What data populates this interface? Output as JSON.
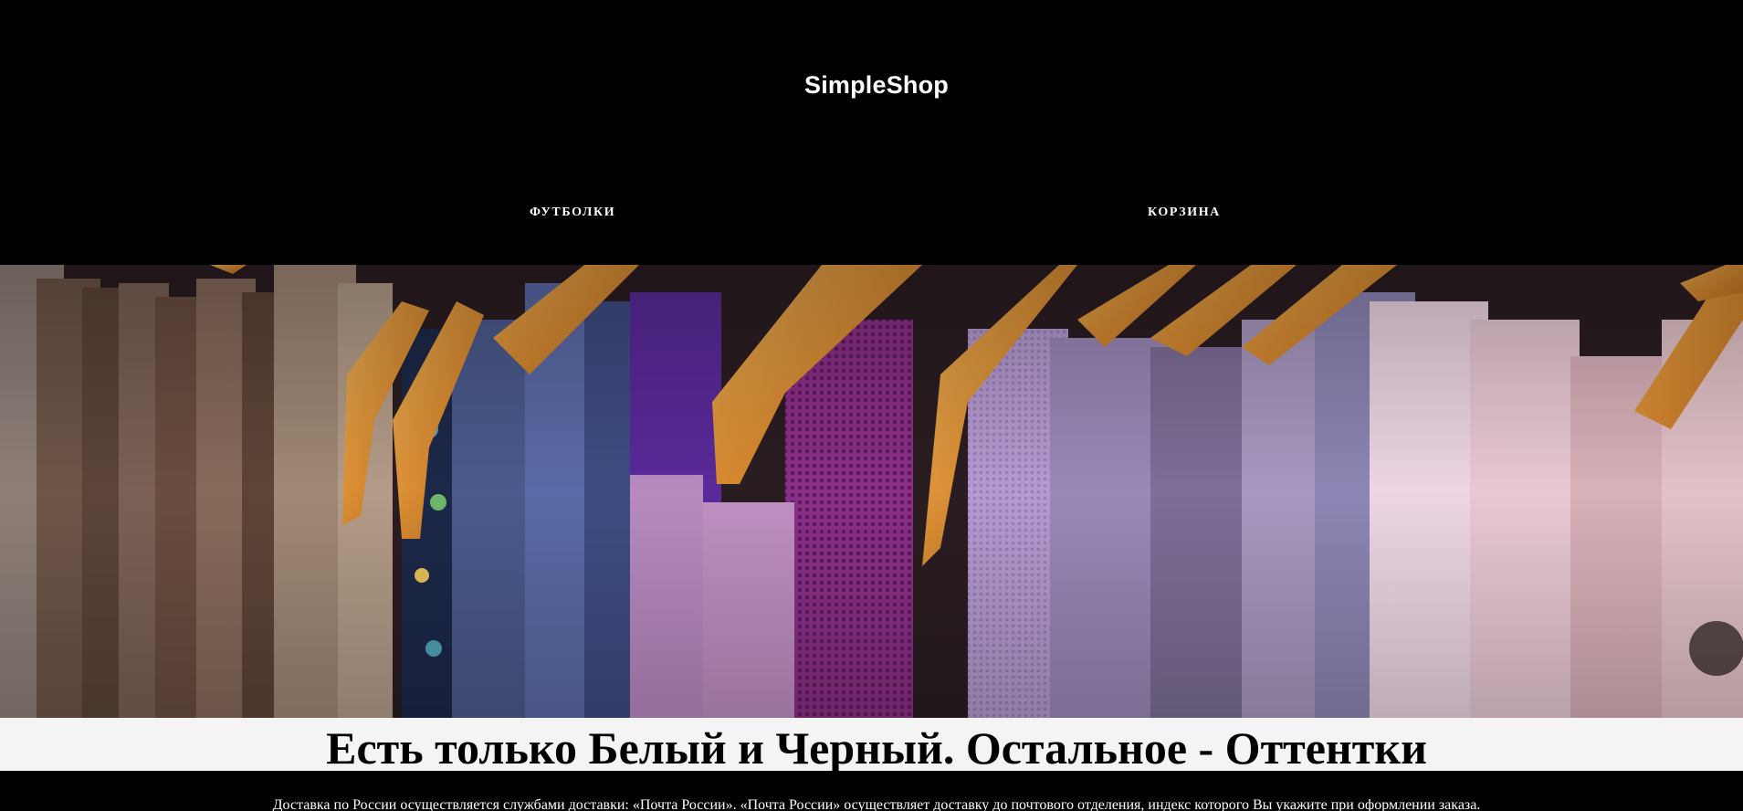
{
  "header": {
    "brand": "SimpleShop",
    "nav": [
      {
        "label": "ФУТБОЛКИ"
      },
      {
        "label": "КОРЗИНА"
      }
    ]
  },
  "hero": {
    "image": "clothes-on-hangers-photo"
  },
  "tagline": "Есть только Белый и Черный. Остальное - Оттентки",
  "delivery_text": "Доставка по России осуществляется службами доставки: «Почта России». «Почта России» осуществляет доставку до почтового отделения, индекс которого Вы укажите при оформлении заказа.",
  "colors": {
    "background": "#000000",
    "header_text": "#ffffff",
    "tagline_band": "#f5f4f4",
    "hanger_wood": "#d9923a"
  }
}
